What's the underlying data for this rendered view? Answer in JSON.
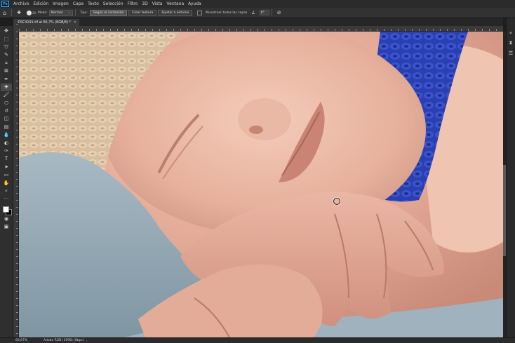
{
  "app": {
    "logo": "Ps"
  },
  "menu": [
    "Archivo",
    "Edición",
    "Imagen",
    "Capa",
    "Texto",
    "Selección",
    "Filtro",
    "3D",
    "Vista",
    "Ventana",
    "Ayuda"
  ],
  "options": {
    "brush_size": "20",
    "mode_label": "Modo:",
    "mode_value": "Normal",
    "type_label": "Tipo:",
    "btn_content": "Según el contenido",
    "btn_texture": "Crear textura",
    "btn_proximity": "Ajustar a entorno",
    "sample_all_label": "Muestrear todas las capas",
    "angle_value": "0°"
  },
  "document": {
    "tab_title": "_DSC4191.tif al 66,7% (RGB/8) *",
    "close_glyph": "×"
  },
  "tools": [
    {
      "name": "move-tool",
      "glyph": "✥"
    },
    {
      "name": "artboard-tool",
      "glyph": "⬚"
    },
    {
      "name": "lasso-tool",
      "glyph": "➰"
    },
    {
      "name": "quick-select-tool",
      "glyph": "✎"
    },
    {
      "name": "crop-tool",
      "glyph": "⌗"
    },
    {
      "name": "frame-tool",
      "glyph": "⊠"
    },
    {
      "name": "eyedropper-tool",
      "glyph": "✒"
    },
    {
      "name": "spot-healing-tool",
      "glyph": "✚",
      "active": true
    },
    {
      "name": "brush-tool",
      "glyph": "🖌"
    },
    {
      "name": "stamp-tool",
      "glyph": "⎔"
    },
    {
      "name": "history-brush-tool",
      "glyph": "↺"
    },
    {
      "name": "eraser-tool",
      "glyph": "◫"
    },
    {
      "name": "gradient-tool",
      "glyph": "▤"
    },
    {
      "name": "blur-tool",
      "glyph": "💧"
    },
    {
      "name": "dodge-tool",
      "glyph": "◐"
    },
    {
      "name": "pen-tool",
      "glyph": "✑"
    },
    {
      "name": "type-tool",
      "glyph": "T"
    },
    {
      "name": "path-select-tool",
      "glyph": "➤"
    },
    {
      "name": "shape-tool",
      "glyph": "▭"
    },
    {
      "name": "hand-tool",
      "glyph": "✋"
    },
    {
      "name": "zoom-tool",
      "glyph": "⌕"
    },
    {
      "name": "more-tools",
      "glyph": "⋯"
    }
  ],
  "bottom_tools": [
    {
      "name": "quick-mask-tool",
      "glyph": "◉"
    },
    {
      "name": "screen-mode-tool",
      "glyph": "▣"
    }
  ],
  "colors": {
    "foreground": "#ffffff",
    "background": "#000000"
  },
  "status": {
    "zoom": "66,67%",
    "profile": "Adobe RGB (1998) (8bpc)",
    "arrow": "›"
  }
}
